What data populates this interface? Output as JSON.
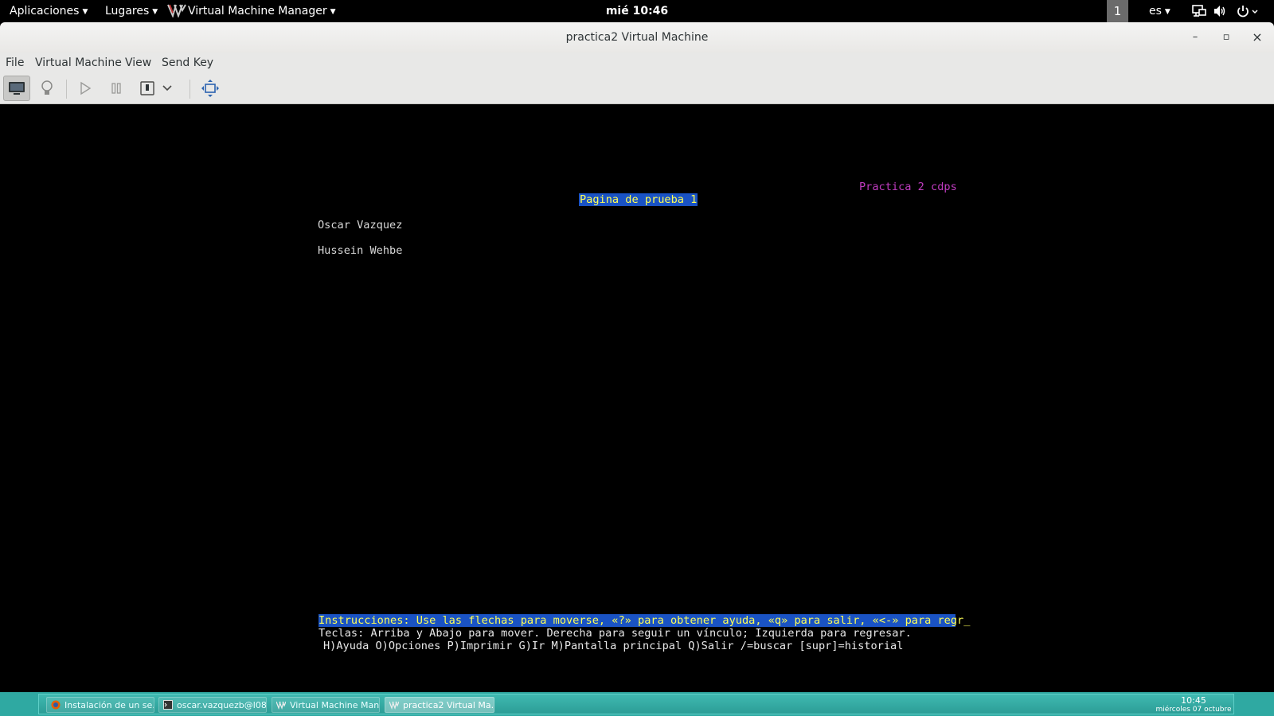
{
  "topbar": {
    "applications": "Aplicaciones",
    "places": "Lugares",
    "app_name": "Virtual Machine Manager",
    "clock": "mié 10:46",
    "workspace": "1",
    "keyboard_layout": "es",
    "icons": [
      "network-icon",
      "volume-icon",
      "power-icon"
    ]
  },
  "window": {
    "title": "practica2 Virtual Machine",
    "controls": {
      "minimize": "–",
      "maximize": "▫",
      "close": "×"
    },
    "menu": [
      "File",
      "Virtual Machine",
      "View",
      "Send Key"
    ],
    "toolbar": [
      "console-icon",
      "details-bulb-icon",
      "run-icon",
      "pause-icon",
      "shutdown-icon",
      "dropdown-chevron-icon",
      "fullscreen-icon"
    ]
  },
  "console": {
    "corner_title": "Practica 2 cdps",
    "heading": "Pagina de prueba 1",
    "authors": [
      "Oscar Vazquez",
      "Hussein Wehbe"
    ],
    "instructions": "Instrucciones: Use las flechas para moverse, «?» para obtener ayuda, «q» para salir, «<-» para regr_",
    "keys": "Teclas: Arriba y Abajo para mover. Derecha para seguir un vínculo; Izquierda para regresar.",
    "commands": "H)Ayuda O)Opciones P)Imprimir G)Ir M)Pantalla principal Q)Salir /=buscar [supr]=historial"
  },
  "taskbar": {
    "tasks": [
      {
        "label": "Instalación de un se...",
        "icon": "firefox-icon"
      },
      {
        "label": "oscar.vazquezb@l08...",
        "icon": "terminal-icon"
      },
      {
        "label": "Virtual Machine Man...",
        "icon": "vmm-icon"
      },
      {
        "label": "practica2 Virtual Ma...",
        "icon": "vm-console-icon",
        "active": true
      }
    ],
    "time": "10:45",
    "date": "miércoles 07 octubre"
  },
  "colors": {
    "console_highlight_bg": "#1a53c4",
    "console_highlight_fg": "#ffff55",
    "console_magenta": "#c03cc0",
    "taskbar": "#2fa9a2"
  }
}
